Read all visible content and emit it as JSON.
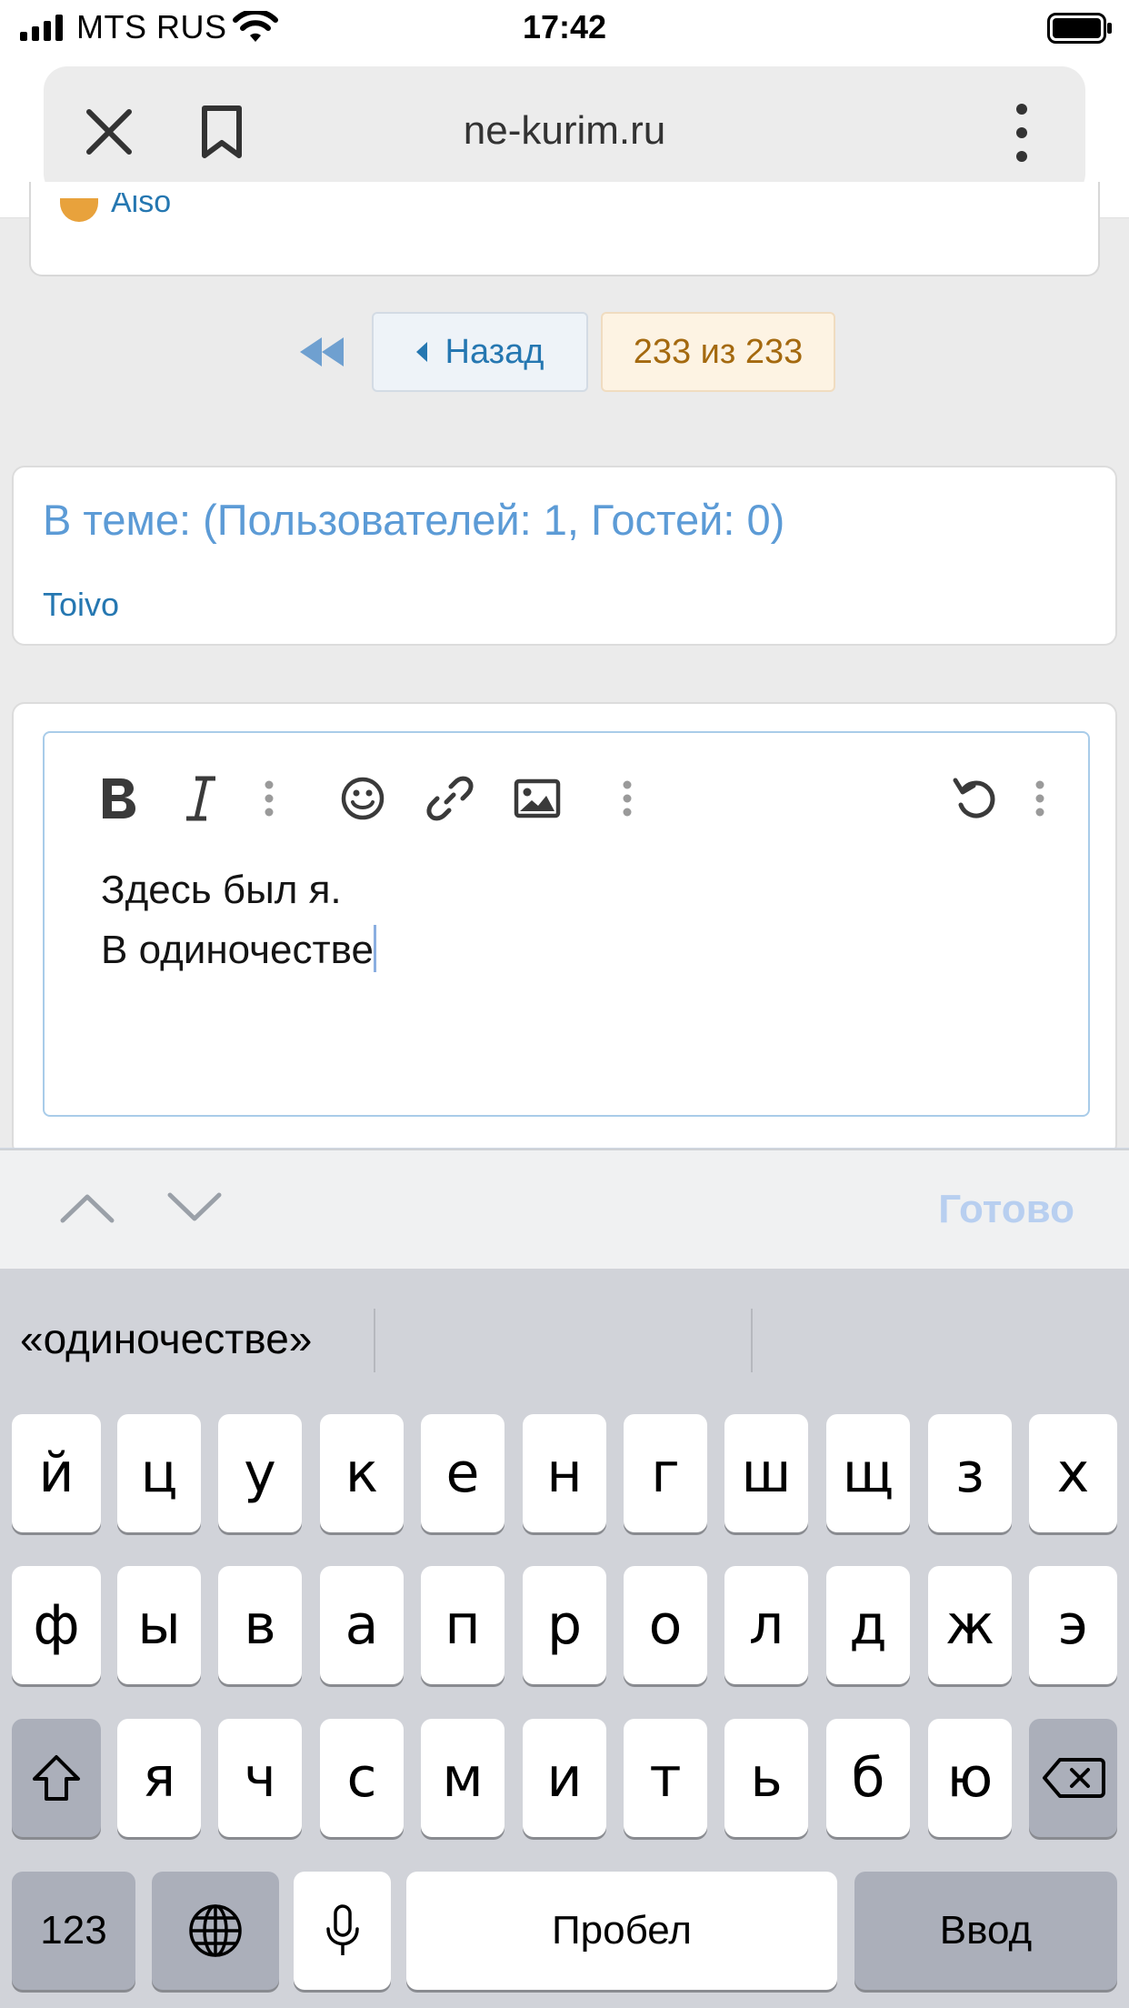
{
  "status_bar": {
    "carrier": "MTS RUS",
    "time": "17:42"
  },
  "browser": {
    "url": "ne-kurim.ru"
  },
  "previous_post": {
    "author_partial": "Aiso"
  },
  "pagination": {
    "back_label": "Назад",
    "current_label": "233 из 233"
  },
  "online_block": {
    "title": "В теме: (Пользователей: 1, Гостей: 0)",
    "users": [
      "Toivo"
    ]
  },
  "editor": {
    "line1": "Здесь был я.",
    "line2": "В одиночестве"
  },
  "accessory": {
    "done_label": "Готово"
  },
  "keyboard": {
    "suggestion": "«одиночестве»",
    "row1": [
      "й",
      "ц",
      "у",
      "к",
      "е",
      "н",
      "г",
      "ш",
      "щ",
      "з",
      "х"
    ],
    "row2": [
      "ф",
      "ы",
      "в",
      "а",
      "п",
      "р",
      "о",
      "л",
      "д",
      "ж",
      "э"
    ],
    "row3": [
      "я",
      "ч",
      "с",
      "м",
      "и",
      "т",
      "ь",
      "б",
      "ю"
    ],
    "numbers_label": "123",
    "space_label": "Пробел",
    "return_label": "Ввод"
  }
}
